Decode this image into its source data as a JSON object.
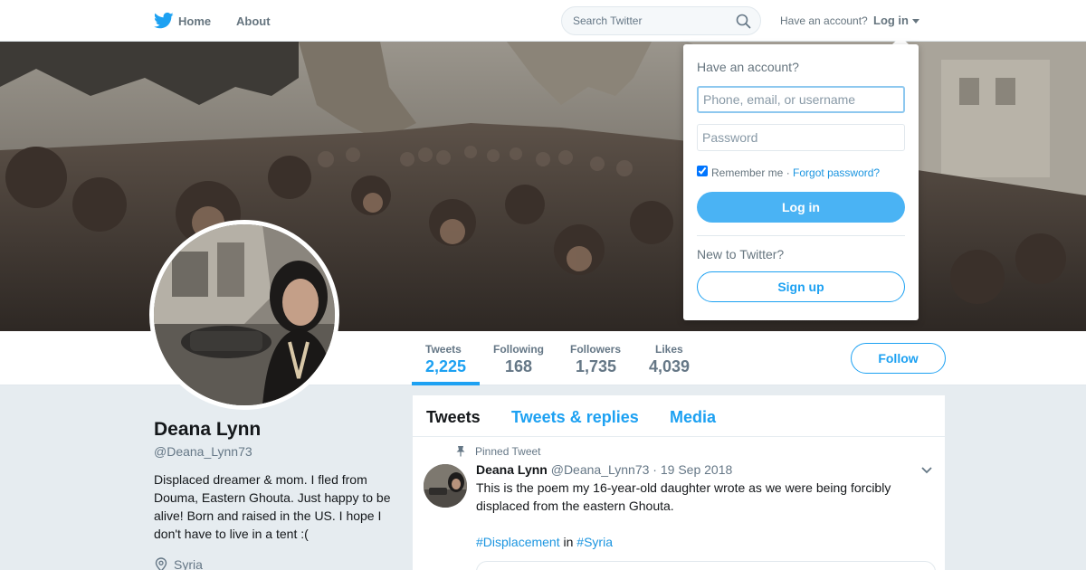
{
  "nav": {
    "home_label": "Home",
    "about_label": "About",
    "search_placeholder": "Search Twitter",
    "have_account": "Have an account?",
    "login_label": "Log in",
    "logo_icon": "twitter-bird-icon",
    "accent_color": "#1da1f2"
  },
  "profile": {
    "name": "Deana Lynn",
    "handle": "@Deana_Lynn73",
    "bio": "Displaced dreamer & mom. I fled from Douma, Eastern Ghouta. Just happy to be alive! Born and raised in the US. I hope I don't have to live in a tent :(",
    "location": "Syria",
    "follow_label": "Follow",
    "stats": [
      {
        "label": "Tweets",
        "value": "2,225"
      },
      {
        "label": "Following",
        "value": "168"
      },
      {
        "label": "Followers",
        "value": "1,735"
      },
      {
        "label": "Likes",
        "value": "4,039"
      }
    ]
  },
  "timeline": {
    "tabs": [
      "Tweets",
      "Tweets & replies",
      "Media"
    ],
    "pinned_label": "Pinned Tweet",
    "tweet": {
      "name": "Deana Lynn",
      "handle": "@Deana_Lynn73",
      "separator": "·",
      "date": "19 Sep 2018",
      "text": "This is the poem my 16-year-old daughter wrote as we were being forcibly displaced from the eastern Ghouta.",
      "hashtag1": "#Displacement",
      "connector": "in",
      "hashtag2": "#Syria"
    }
  },
  "login_dropdown": {
    "title": "Have an account?",
    "username_placeholder": "Phone, email, or username",
    "password_placeholder": "Password",
    "remember_label": "Remember me",
    "separator": "·",
    "forgot_label": "Forgot password?",
    "login_button": "Log in",
    "new_label": "New to Twitter?",
    "signup_button": "Sign up"
  }
}
